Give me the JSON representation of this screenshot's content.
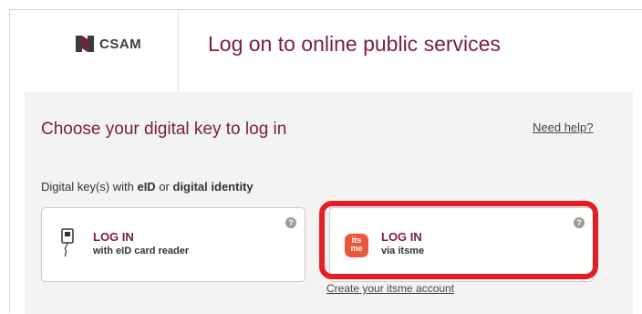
{
  "brand": {
    "logo_text": "CSAM",
    "logo_icon": "csam-logo-icon"
  },
  "header": {
    "title": "Log on to online public services"
  },
  "panel": {
    "title": "Choose your digital key to log in",
    "help_link": "Need help?",
    "keys_label": {
      "prefix": "Digital key(s) with ",
      "eid": "eID",
      "middle": " or ",
      "digital_identity": "digital identity"
    }
  },
  "cards": [
    {
      "main": "LOG IN",
      "sub": "with eID card reader",
      "icon": "card-reader-icon",
      "help_icon": "?"
    },
    {
      "main": "LOG IN",
      "sub": "via itsme",
      "icon": "itsme-logo-icon",
      "badge_line1": "its",
      "badge_line2": "me",
      "help_icon": "?"
    }
  ],
  "create_link": "Create your itsme account",
  "colors": {
    "accent": "#7a1e3e",
    "highlight": "#e31e24",
    "itsme": "#e8593a"
  }
}
